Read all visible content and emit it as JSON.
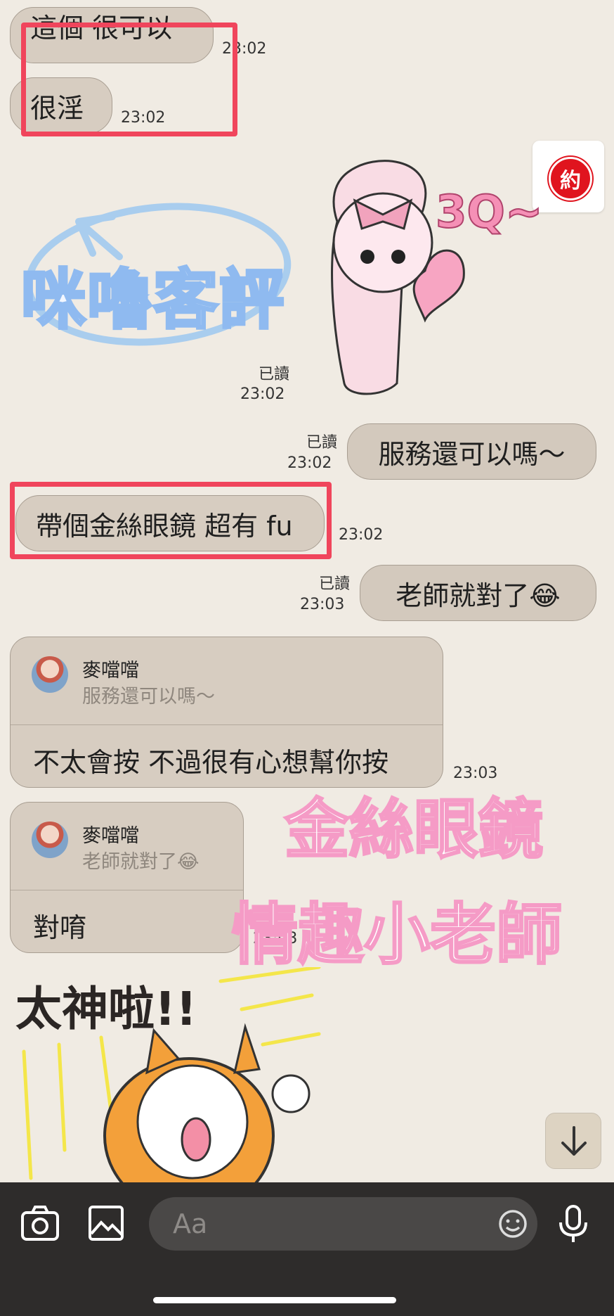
{
  "messages": {
    "m1": {
      "text": "這個 很可以",
      "time": "23:02"
    },
    "m2": {
      "text": "很淫",
      "time": "23:02"
    },
    "sticker_rabbit": {
      "overlay_text": "咪嚕客評",
      "sticker_text": "3Q~",
      "read": "已讀",
      "time": "23:02"
    },
    "m3": {
      "text": "服務還可以嗎～",
      "read": "已讀",
      "time": "23:02"
    },
    "m4": {
      "text": "帶個金絲眼鏡  超有 fu",
      "time": "23:02"
    },
    "m5": {
      "text": "老師就對了😂",
      "read": "已讀",
      "time": "23:03"
    },
    "r1": {
      "name": "麥噹噹",
      "quote": "服務還可以嗎～",
      "text": "不太會按  不過很有心想幫你按",
      "time": "23:03"
    },
    "r2": {
      "name": "麥噹噹",
      "quote": "老師就對了😂",
      "text": "對唷",
      "time": "23:03"
    },
    "pink_caption": {
      "line1": "金絲眼鏡",
      "line2": "情趣小老師"
    },
    "sticker_cat": {
      "text": "太神啦!!"
    }
  },
  "badge": {
    "label": "約",
    "color": "#e0141e"
  },
  "input": {
    "placeholder": "Aa"
  },
  "colors": {
    "bubble": "#d7cdc1",
    "background": "#f0ebe3",
    "highlight": "#f0455c",
    "bottom_bar": "#2e2c2b"
  },
  "icons": [
    "camera-icon",
    "image-icon",
    "emoji-icon",
    "microphone-icon",
    "arrow-down-icon"
  ]
}
